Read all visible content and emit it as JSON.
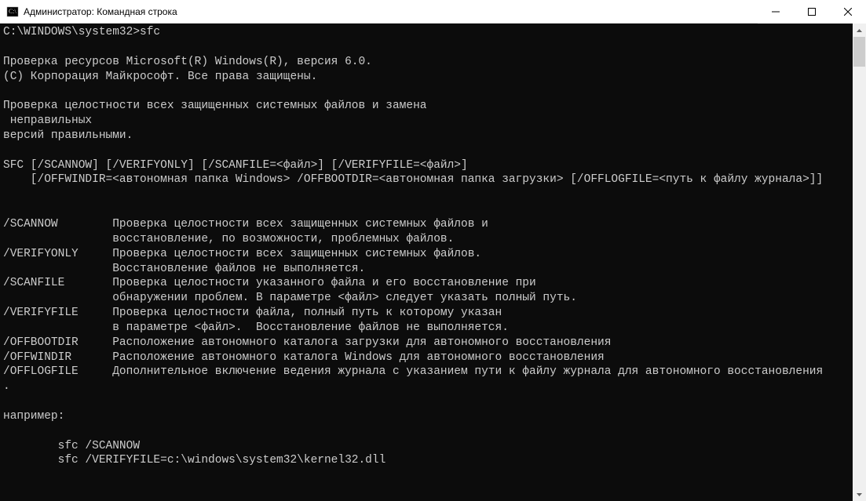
{
  "window": {
    "title": "Администратор: Командная строка"
  },
  "terminal": {
    "prompt": "C:\\WINDOWS\\system32>sfc",
    "blank": "",
    "header1": "Проверка ресурсов Microsoft(R) Windows(R), версия 6.0.",
    "header2": "(C) Корпорация Майкрософт. Все права защищены.",
    "desc1": "Проверка целостности всех защищенных системных файлов и замена",
    "desc2": " неправильных",
    "desc3": "версий правильными.",
    "usage1": "SFC [/SCANNOW] [/VERIFYONLY] [/SCANFILE=<файл>] [/VERIFYFILE=<файл>]",
    "usage2": "    [/OFFWINDIR=<автономная папка Windows> /OFFBOOTDIR=<автономная папка загрузки> [/OFFLOGFILE=<путь к файлу журнала>]]",
    "opt_scannow_1": "/SCANNOW        Проверка целостности всех защищенных системных файлов и",
    "opt_scannow_2": "                восстановление, по возможности, проблемных файлов.",
    "opt_verifyonly_1": "/VERIFYONLY     Проверка целостности всех защищенных системных файлов.",
    "opt_verifyonly_2": "                Восстановление файлов не выполняется.",
    "opt_scanfile_1": "/SCANFILE       Проверка целостности указанного файла и его восстановление при",
    "opt_scanfile_2": "                обнаружении проблем. В параметре <файл> следует указать полный путь.",
    "opt_verifyfile_1": "/VERIFYFILE     Проверка целостности файла, полный путь к которому указан",
    "opt_verifyfile_2": "                в параметре <файл>.  Восстановление файлов не выполняется.",
    "opt_offbootdir": "/OFFBOOTDIR     Расположение автономного каталога загрузки для автономного восстановления",
    "opt_offwindir": "/OFFWINDIR      Расположение автономного каталога Windows для автономного восстановления",
    "opt_offlogfile": "/OFFLOGFILE     Дополнительное включение ведения журнала с указанием пути к файлу журнала для автономного восстановления",
    "dot": ".",
    "example_label": "например:",
    "example1": "        sfc /SCANNOW",
    "example2": "        sfc /VERIFYFILE=c:\\windows\\system32\\kernel32.dll"
  }
}
